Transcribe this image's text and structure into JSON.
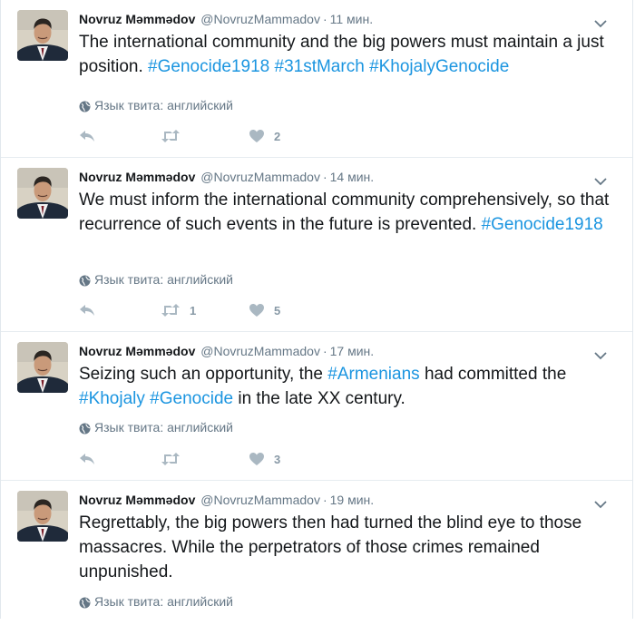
{
  "tweets": [
    {
      "name": "Novruz Məmmədov",
      "handle": "@NovruzMammadov",
      "time": "11 мин.",
      "text": [
        {
          "t": "The international community and the big powers must maintain a just position. "
        },
        {
          "t": "#Genocide1918",
          "tag": true
        },
        {
          "t": " "
        },
        {
          "t": "#31stMarch",
          "tag": true
        },
        {
          "t": " "
        },
        {
          "t": "#KhojalyGenocide",
          "tag": true
        }
      ],
      "language": "Язык твита: английский",
      "retweets": "",
      "likes": "2"
    },
    {
      "name": "Novruz Məmmədov",
      "handle": "@NovruzMammadov",
      "time": "14 мин.",
      "text": [
        {
          "t": "We must inform the international community comprehensively, so that recurrence of such events in the future is prevented. "
        },
        {
          "t": "#Genocide1918",
          "tag": true
        }
      ],
      "language": "Язык твита: английский",
      "retweets": "1",
      "likes": "5"
    },
    {
      "name": "Novruz Məmmədov",
      "handle": "@NovruzMammadov",
      "time": "17 мин.",
      "text": [
        {
          "t": "Seizing such an opportunity, the "
        },
        {
          "t": "#Armenians",
          "tag": true
        },
        {
          "t": " had committed the "
        },
        {
          "t": "#Khojaly",
          "tag": true
        },
        {
          "t": " "
        },
        {
          "t": "#Genocide",
          "tag": true
        },
        {
          "t": " in the late XX century."
        }
      ],
      "language": "Язык твита: английский",
      "retweets": "",
      "likes": "3"
    },
    {
      "name": "Novruz Məmmədov",
      "handle": "@NovruzMammadov",
      "time": "19 мин.",
      "text": [
        {
          "t": "Regrettably, the big powers then had turned the blind eye to those massacres. While the perpetrators of those crimes remained unpunished."
        }
      ],
      "language": "Язык твита: английский",
      "retweets": "",
      "likes": ""
    }
  ],
  "colors": {
    "link": "#1b95e0",
    "muted": "#657786",
    "action": "#aab8c2"
  },
  "icons": [
    "chevron-down-icon",
    "globe-icon",
    "reply-icon",
    "retweet-icon",
    "heart-icon"
  ]
}
